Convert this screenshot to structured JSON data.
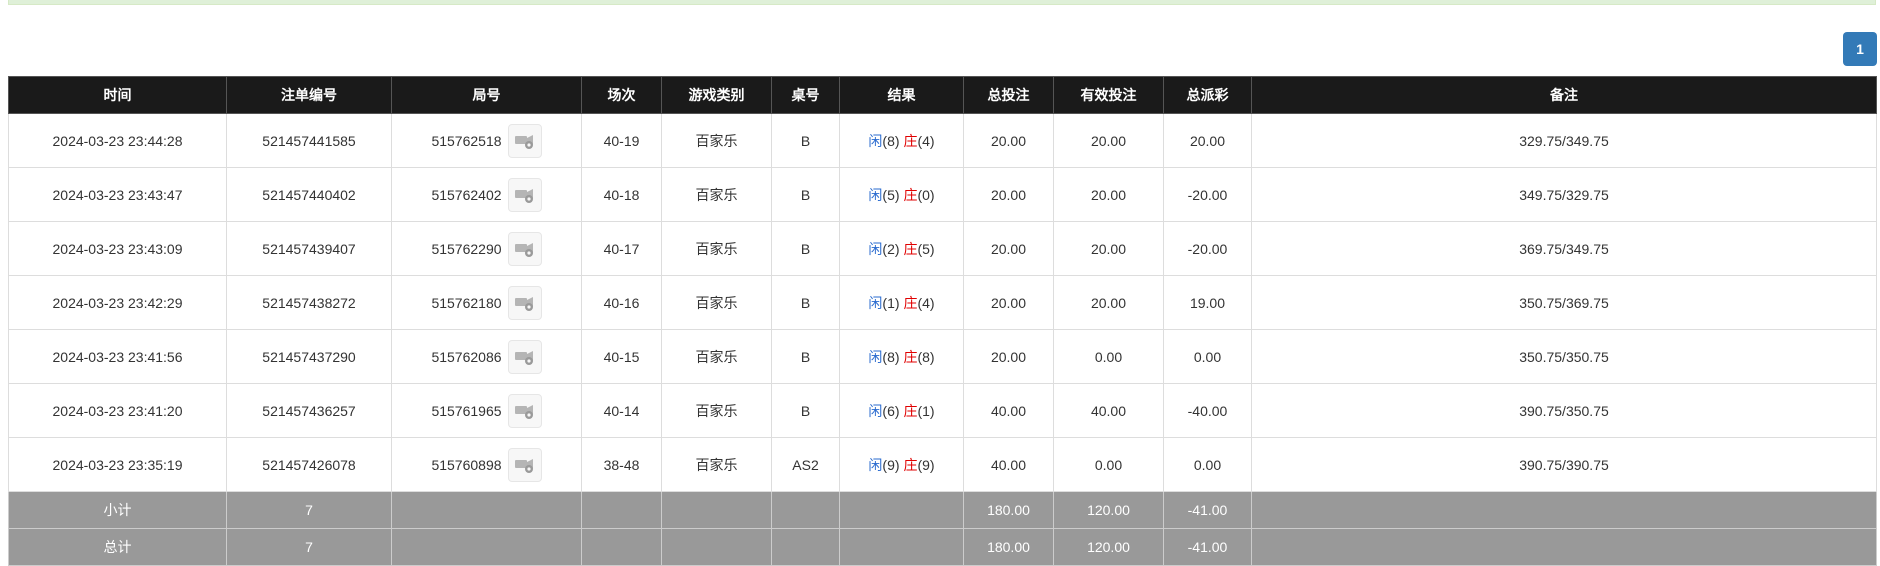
{
  "pagination": {
    "current_page": "1"
  },
  "table": {
    "headers": [
      "时间",
      "注单编号",
      "局号",
      "场次",
      "游戏类别",
      "桌号",
      "结果",
      "总投注",
      "有效投注",
      "总派彩",
      "备注"
    ],
    "rows": [
      {
        "time": "2024-03-23 23:44:28",
        "bet_id": "521457441585",
        "round": "515762518",
        "session": "40-19",
        "game": "百家乐",
        "table": "B",
        "player_label": "闲",
        "player_score": "(8)",
        "banker_label": "庄",
        "banker_score": "(4)",
        "total_bet": "20.00",
        "valid_bet": "20.00",
        "payout": "20.00",
        "payout_negative": false,
        "note": "329.75/349.75"
      },
      {
        "time": "2024-03-23 23:43:47",
        "bet_id": "521457440402",
        "round": "515762402",
        "session": "40-18",
        "game": "百家乐",
        "table": "B",
        "player_label": "闲",
        "player_score": "(5)",
        "banker_label": "庄",
        "banker_score": "(0)",
        "total_bet": "20.00",
        "valid_bet": "20.00",
        "payout": "-20.00",
        "payout_negative": true,
        "note": "349.75/329.75"
      },
      {
        "time": "2024-03-23 23:43:09",
        "bet_id": "521457439407",
        "round": "515762290",
        "session": "40-17",
        "game": "百家乐",
        "table": "B",
        "player_label": "闲",
        "player_score": "(2)",
        "banker_label": "庄",
        "banker_score": "(5)",
        "total_bet": "20.00",
        "valid_bet": "20.00",
        "payout": "-20.00",
        "payout_negative": true,
        "note": "369.75/349.75"
      },
      {
        "time": "2024-03-23 23:42:29",
        "bet_id": "521457438272",
        "round": "515762180",
        "session": "40-16",
        "game": "百家乐",
        "table": "B",
        "player_label": "闲",
        "player_score": "(1)",
        "banker_label": "庄",
        "banker_score": "(4)",
        "total_bet": "20.00",
        "valid_bet": "20.00",
        "payout": "19.00",
        "payout_negative": false,
        "note": "350.75/369.75"
      },
      {
        "time": "2024-03-23 23:41:56",
        "bet_id": "521457437290",
        "round": "515762086",
        "session": "40-15",
        "game": "百家乐",
        "table": "B",
        "player_label": "闲",
        "player_score": "(8)",
        "banker_label": "庄",
        "banker_score": "(8)",
        "total_bet": "20.00",
        "valid_bet": "0.00",
        "payout": "0.00",
        "payout_negative": false,
        "note": "350.75/350.75"
      },
      {
        "time": "2024-03-23 23:41:20",
        "bet_id": "521457436257",
        "round": "515761965",
        "session": "40-14",
        "game": "百家乐",
        "table": "B",
        "player_label": "闲",
        "player_score": "(6)",
        "banker_label": "庄",
        "banker_score": "(1)",
        "total_bet": "40.00",
        "valid_bet": "40.00",
        "payout": "-40.00",
        "payout_negative": true,
        "note": "390.75/350.75"
      },
      {
        "time": "2024-03-23 23:35:19",
        "bet_id": "521457426078",
        "round": "515760898",
        "session": "38-48",
        "game": "百家乐",
        "table": "AS2",
        "player_label": "闲",
        "player_score": "(9)",
        "banker_label": "庄",
        "banker_score": "(9)",
        "total_bet": "40.00",
        "valid_bet": "0.00",
        "payout": "0.00",
        "payout_negative": false,
        "note": "390.75/390.75"
      }
    ],
    "subtotal": {
      "label": "小计",
      "count": "7",
      "total_bet": "180.00",
      "valid_bet": "120.00",
      "payout": "-41.00"
    },
    "total": {
      "label": "总计",
      "count": "7",
      "total_bet": "180.00",
      "valid_bet": "120.00",
      "payout": "-41.00"
    }
  },
  "colors": {
    "header_bg": "#1a1a1a",
    "footer_bg": "#999999",
    "player_blue": "#2a6bcf",
    "banker_red": "#e00000",
    "pager_blue": "#337ab7",
    "alert_green": "#dff0d8"
  },
  "icons": {
    "round_detail": "video-camera-gear-icon"
  }
}
